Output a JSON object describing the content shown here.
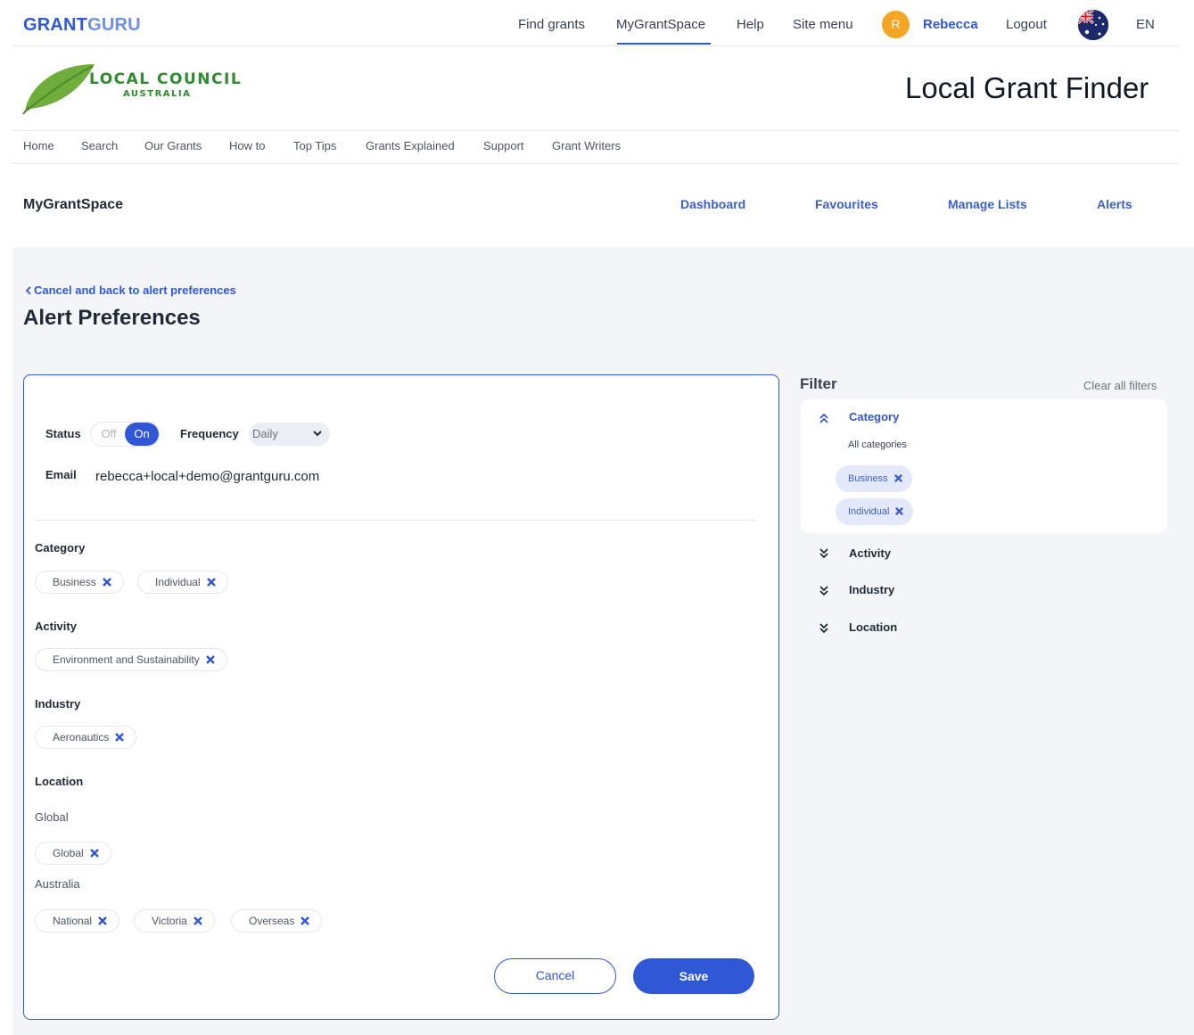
{
  "brand": {
    "part1": "GRANT",
    "part2": "GURU"
  },
  "top_nav": {
    "find_grants": "Find grants",
    "my_grant_space": "MyGrantSpace",
    "help": "Help",
    "site_menu": "Site menu",
    "avatar_initial": "R",
    "user_name": "Rebecca",
    "logout": "Logout",
    "language": "EN"
  },
  "council": {
    "name": "LOCAL COUNCIL",
    "country": "AUSTRALIA",
    "finder_title": "Local Grant Finder"
  },
  "sub_nav": [
    "Home",
    "Search",
    "Our Grants",
    "How to",
    "Top Tips",
    "Grants Explained",
    "Support",
    "Grant Writers"
  ],
  "my_grant_space": {
    "title": "MyGrantSpace",
    "nav": [
      "Dashboard",
      "Favourites",
      "Manage Lists",
      "Alerts"
    ]
  },
  "page": {
    "back_link": "Cancel and back to alert preferences",
    "title": "Alert Preferences"
  },
  "form": {
    "status_label": "Status",
    "toggle_off": "Off",
    "toggle_on": "On",
    "frequency_label": "Frequency",
    "frequency_value": "Daily",
    "email_label": "Email",
    "email_value": "rebecca+local+demo@grantguru.com",
    "category_label": "Category",
    "category_chips": [
      "Business",
      "Individual"
    ],
    "activity_label": "Activity",
    "activity_chips": [
      "Environment and Sustainability"
    ],
    "industry_label": "Industry",
    "industry_chips": [
      "Aeronautics"
    ],
    "location_label": "Location",
    "location_global_heading": "Global",
    "location_global_chips": [
      "Global"
    ],
    "location_australia_heading": "Australia",
    "location_australia_chips": [
      "National",
      "Victoria",
      "Overseas"
    ],
    "cancel_label": "Cancel",
    "save_label": "Save"
  },
  "filter": {
    "title": "Filter",
    "clear_all": "Clear all filters",
    "category": {
      "label": "Category",
      "all_label": "All categories",
      "chips": [
        "Business",
        "Individual"
      ]
    },
    "activity_label": "Activity",
    "industry_label": "Industry",
    "location_label": "Location"
  },
  "colors": {
    "accent": "#2f57d6",
    "background_grey": "#f3f5f9",
    "chip_fill_filter": "#e4e8fb",
    "avatar": "#f5a524",
    "leaf_green": "#2f8b2f"
  }
}
